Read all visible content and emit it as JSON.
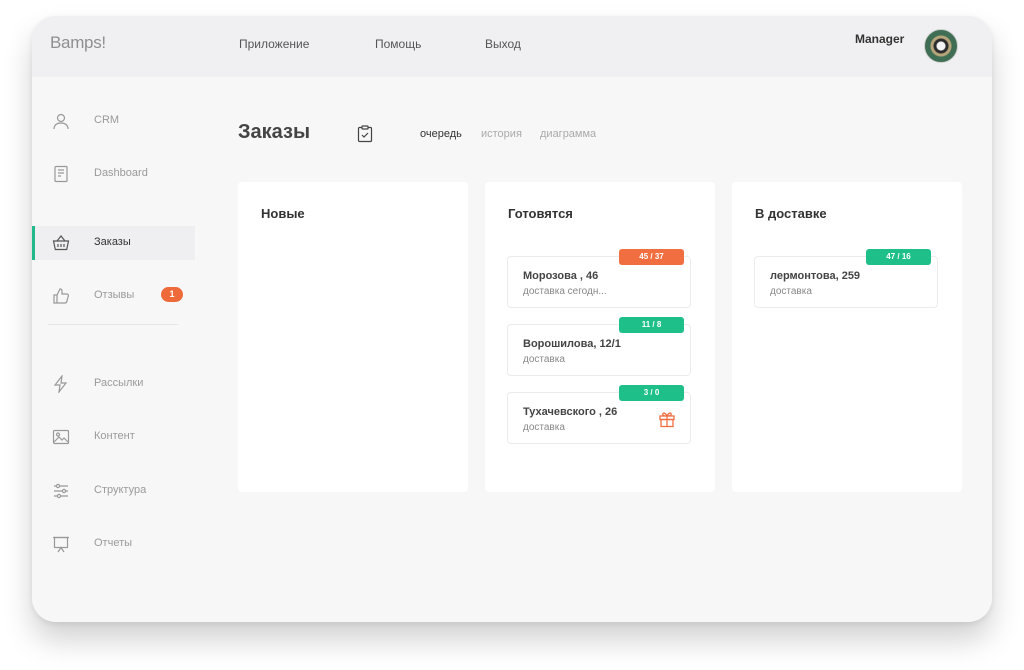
{
  "app": {
    "logo": "Bamps!",
    "nav": [
      "Приложение",
      "Помощь",
      "Выход"
    ],
    "user": "Manager"
  },
  "sidebar": {
    "items": [
      {
        "label": "CRM",
        "icon": "user-icon"
      },
      {
        "label": "Dashboard",
        "icon": "document-icon"
      },
      {
        "label": "Заказы",
        "icon": "basket-icon",
        "active": true
      },
      {
        "label": "Отзывы",
        "icon": "thumbs-up-icon",
        "badge": "1"
      },
      {
        "label": "Рассылки",
        "icon": "lightning-icon"
      },
      {
        "label": "Контент",
        "icon": "image-icon"
      },
      {
        "label": "Структура",
        "icon": "sliders-icon"
      },
      {
        "label": "Отчеты",
        "icon": "presentation-icon"
      }
    ]
  },
  "main": {
    "title": "Заказы",
    "tabs": [
      "очередь",
      "история",
      "диаграмма"
    ],
    "columns": [
      {
        "title": "Новые",
        "cards": []
      },
      {
        "title": "Готовятся",
        "cards": [
          {
            "title": "Морозова , 46",
            "subtitle": "доставка сегодн...",
            "pill": "45 / 37",
            "pill_color": "#f06e40"
          },
          {
            "title": "Ворошилова, 12/1",
            "subtitle": "доставка",
            "pill": "11 / 8",
            "pill_color": "#1fbf8a"
          },
          {
            "title": "Тухачевского , 26",
            "subtitle": "доставка",
            "pill": "3 / 0",
            "pill_color": "#1fbf8a",
            "icon": "gift-icon"
          }
        ]
      },
      {
        "title": "В доставке",
        "cards": [
          {
            "title": "лермонтова, 259",
            "subtitle": "доставка",
            "pill": "47 / 16",
            "pill_color": "#1fbf8a"
          }
        ]
      }
    ]
  },
  "colors": {
    "accent": "#22b98a",
    "warning": "#f06e40",
    "badge": "#ef6a3a"
  }
}
